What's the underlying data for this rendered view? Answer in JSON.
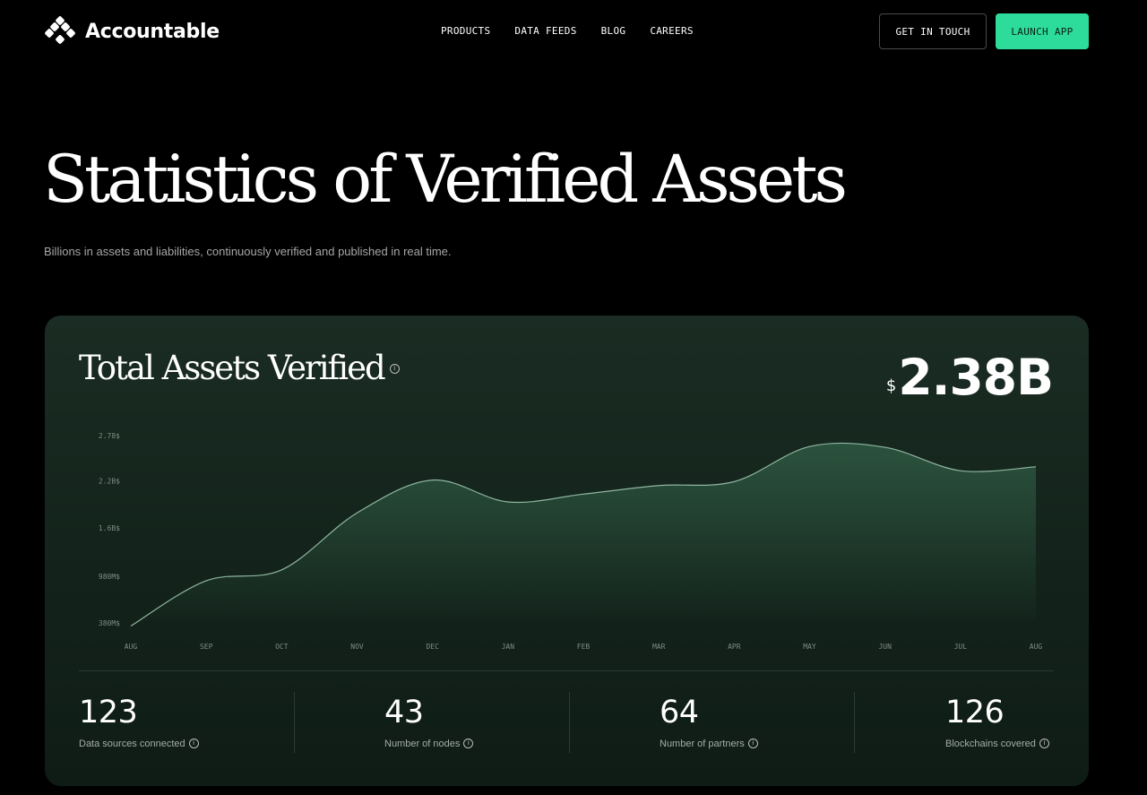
{
  "brand": {
    "name": "Accountable"
  },
  "nav": {
    "items": [
      "PRODUCTS",
      "DATA FEEDS",
      "BLOG",
      "CAREERS"
    ],
    "get_in_touch": "GET IN TOUCH",
    "launch_app": "LAUNCH APP"
  },
  "hero": {
    "title": "Statistics of Verified Assets",
    "subtitle": "Billions in assets and liabilities, continuously verified and published in real time."
  },
  "panel": {
    "title": "Total Assets Verified",
    "total_currency": "$",
    "total_value": "2.38B"
  },
  "chart_data": {
    "type": "area",
    "x": [
      "AUG",
      "SEP",
      "OCT",
      "NOV",
      "DEC",
      "JAN",
      "FEB",
      "MAR",
      "APR",
      "MAY",
      "JUN",
      "JUL",
      "AUG"
    ],
    "values": [
      0.34,
      0.92,
      1.06,
      1.79,
      2.21,
      1.93,
      2.03,
      2.14,
      2.19,
      2.64,
      2.63,
      2.33,
      2.38
    ],
    "value_unit": "B$",
    "y_ticks": [
      "2.78$",
      "2.2B$",
      "1.6B$",
      "980M$",
      "380M$"
    ],
    "y_tick_values": [
      2.78,
      2.2,
      1.6,
      0.98,
      0.38
    ],
    "ylim": [
      0.38,
      2.78
    ],
    "grid": false,
    "line_color": "#8fb5a0",
    "fill_color": "#2f5a43"
  },
  "stats": [
    {
      "value": "123",
      "label": "Data sources connected"
    },
    {
      "value": "43",
      "label": "Number of nodes"
    },
    {
      "value": "64",
      "label": "Number of partners"
    },
    {
      "value": "126",
      "label": "Blockchains covered"
    }
  ],
  "icons": {
    "info": "info-icon",
    "logo": "accountable-logo-icon"
  },
  "colors": {
    "accent": "#2ddc9a",
    "panel_bg": "#16271f",
    "background": "#000000"
  }
}
